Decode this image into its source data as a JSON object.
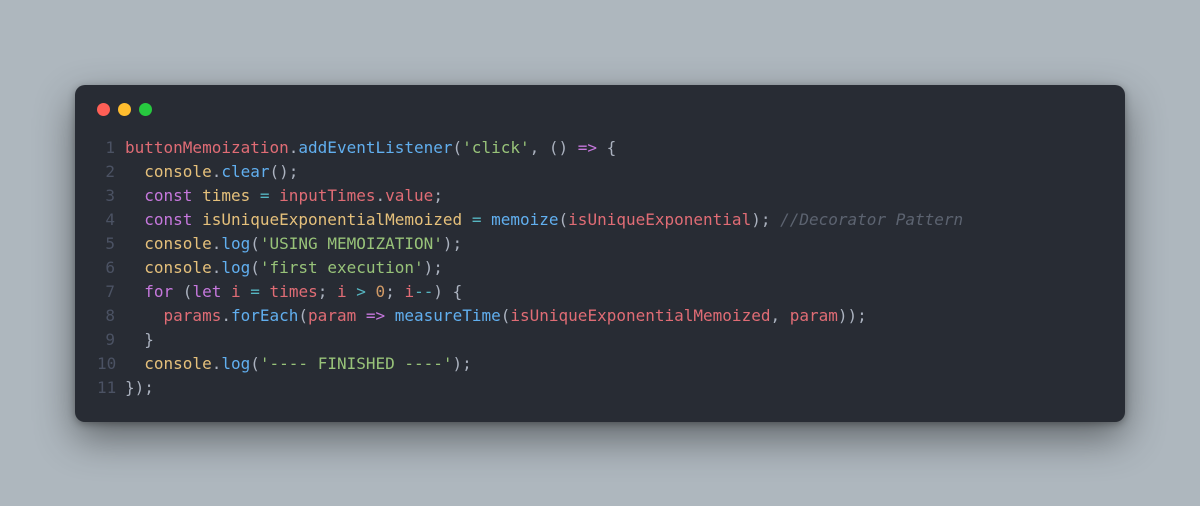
{
  "colors": {
    "bg_page": "#aeb7be",
    "bg_editor": "#282c34",
    "dot_red": "#ff5f56",
    "dot_yellow": "#ffbd2e",
    "dot_green": "#27c93f",
    "gutter": "#4b5263",
    "default": "#abb2bf",
    "method": "#61afef",
    "keyword": "#c678dd",
    "ident": "#e06c75",
    "number": "#d19a66",
    "string": "#98c379",
    "operator": "#56b6c2",
    "property": "#e5c07b",
    "comment": "#5c6370"
  },
  "chart_data": {
    "type": "table",
    "title": "Code snippet (JavaScript)",
    "lines": [
      "buttonMemoization.addEventListener('click', () => {",
      "  console.clear();",
      "  const times = inputTimes.value;",
      "  const isUniqueExponentialMemoized = memoize(isUniqueExponential); //Decorator Pattern",
      "  console.log('USING MEMOIZATION');",
      "  console.log('first execution');",
      "  for (let i = times; i > 0; i--) {",
      "    params.forEach(param => measureTime(isUniqueExponentialMemoized, param));",
      "  }",
      "  console.log('---- FINISHED ----');",
      "});"
    ]
  },
  "code": [
    {
      "n": "1",
      "t": [
        {
          "c": "tok-red",
          "s": "buttonMemoization"
        },
        {
          "c": "tok-default",
          "s": "."
        },
        {
          "c": "tok-method",
          "s": "addEventListener"
        },
        {
          "c": "tok-default",
          "s": "("
        },
        {
          "c": "tok-green",
          "s": "'click'"
        },
        {
          "c": "tok-default",
          "s": ", () "
        },
        {
          "c": "tok-purple",
          "s": "=>"
        },
        {
          "c": "tok-default",
          "s": " {"
        }
      ]
    },
    {
      "n": "2",
      "t": [
        {
          "c": "tok-default",
          "s": "  "
        },
        {
          "c": "tok-yellow",
          "s": "console"
        },
        {
          "c": "tok-default",
          "s": "."
        },
        {
          "c": "tok-method",
          "s": "clear"
        },
        {
          "c": "tok-default",
          "s": "();"
        }
      ]
    },
    {
      "n": "3",
      "t": [
        {
          "c": "tok-default",
          "s": "  "
        },
        {
          "c": "tok-purple",
          "s": "const"
        },
        {
          "c": "tok-default",
          "s": " "
        },
        {
          "c": "tok-yellow",
          "s": "times"
        },
        {
          "c": "tok-default",
          "s": " "
        },
        {
          "c": "tok-cyan",
          "s": "="
        },
        {
          "c": "tok-default",
          "s": " "
        },
        {
          "c": "tok-red",
          "s": "inputTimes"
        },
        {
          "c": "tok-default",
          "s": "."
        },
        {
          "c": "tok-red",
          "s": "value"
        },
        {
          "c": "tok-default",
          "s": ";"
        }
      ]
    },
    {
      "n": "4",
      "t": [
        {
          "c": "tok-default",
          "s": "  "
        },
        {
          "c": "tok-purple",
          "s": "const"
        },
        {
          "c": "tok-default",
          "s": " "
        },
        {
          "c": "tok-yellow",
          "s": "isUniqueExponentialMemoized"
        },
        {
          "c": "tok-default",
          "s": " "
        },
        {
          "c": "tok-cyan",
          "s": "="
        },
        {
          "c": "tok-default",
          "s": " "
        },
        {
          "c": "tok-method",
          "s": "memoize"
        },
        {
          "c": "tok-default",
          "s": "("
        },
        {
          "c": "tok-red",
          "s": "isUniqueExponential"
        },
        {
          "c": "tok-default",
          "s": "); "
        },
        {
          "c": "tok-comment",
          "s": "//Decorator Pattern"
        }
      ]
    },
    {
      "n": "5",
      "t": [
        {
          "c": "tok-default",
          "s": "  "
        },
        {
          "c": "tok-yellow",
          "s": "console"
        },
        {
          "c": "tok-default",
          "s": "."
        },
        {
          "c": "tok-method",
          "s": "log"
        },
        {
          "c": "tok-default",
          "s": "("
        },
        {
          "c": "tok-green",
          "s": "'USING MEMOIZATION'"
        },
        {
          "c": "tok-default",
          "s": ");"
        }
      ]
    },
    {
      "n": "6",
      "t": [
        {
          "c": "tok-default",
          "s": "  "
        },
        {
          "c": "tok-yellow",
          "s": "console"
        },
        {
          "c": "tok-default",
          "s": "."
        },
        {
          "c": "tok-method",
          "s": "log"
        },
        {
          "c": "tok-default",
          "s": "("
        },
        {
          "c": "tok-green",
          "s": "'first execution'"
        },
        {
          "c": "tok-default",
          "s": ");"
        }
      ]
    },
    {
      "n": "7",
      "t": [
        {
          "c": "tok-default",
          "s": "  "
        },
        {
          "c": "tok-purple",
          "s": "for"
        },
        {
          "c": "tok-default",
          "s": " ("
        },
        {
          "c": "tok-purple",
          "s": "let"
        },
        {
          "c": "tok-default",
          "s": " "
        },
        {
          "c": "tok-red",
          "s": "i"
        },
        {
          "c": "tok-default",
          "s": " "
        },
        {
          "c": "tok-cyan",
          "s": "="
        },
        {
          "c": "tok-default",
          "s": " "
        },
        {
          "c": "tok-red",
          "s": "times"
        },
        {
          "c": "tok-default",
          "s": "; "
        },
        {
          "c": "tok-red",
          "s": "i"
        },
        {
          "c": "tok-default",
          "s": " "
        },
        {
          "c": "tok-cyan",
          "s": ">"
        },
        {
          "c": "tok-default",
          "s": " "
        },
        {
          "c": "tok-orange",
          "s": "0"
        },
        {
          "c": "tok-default",
          "s": "; "
        },
        {
          "c": "tok-red",
          "s": "i"
        },
        {
          "c": "tok-cyan",
          "s": "--"
        },
        {
          "c": "tok-default",
          "s": ") {"
        }
      ]
    },
    {
      "n": "8",
      "t": [
        {
          "c": "tok-default",
          "s": "    "
        },
        {
          "c": "tok-red",
          "s": "params"
        },
        {
          "c": "tok-default",
          "s": "."
        },
        {
          "c": "tok-method",
          "s": "forEach"
        },
        {
          "c": "tok-default",
          "s": "("
        },
        {
          "c": "tok-red",
          "s": "param"
        },
        {
          "c": "tok-default",
          "s": " "
        },
        {
          "c": "tok-purple",
          "s": "=>"
        },
        {
          "c": "tok-default",
          "s": " "
        },
        {
          "c": "tok-method",
          "s": "measureTime"
        },
        {
          "c": "tok-default",
          "s": "("
        },
        {
          "c": "tok-red",
          "s": "isUniqueExponentialMemoized"
        },
        {
          "c": "tok-default",
          "s": ", "
        },
        {
          "c": "tok-red",
          "s": "param"
        },
        {
          "c": "tok-default",
          "s": "));"
        }
      ]
    },
    {
      "n": "9",
      "t": [
        {
          "c": "tok-default",
          "s": "  }"
        }
      ]
    },
    {
      "n": "10",
      "t": [
        {
          "c": "tok-default",
          "s": "  "
        },
        {
          "c": "tok-yellow",
          "s": "console"
        },
        {
          "c": "tok-default",
          "s": "."
        },
        {
          "c": "tok-method",
          "s": "log"
        },
        {
          "c": "tok-default",
          "s": "("
        },
        {
          "c": "tok-green",
          "s": "'---- FINISHED ----'"
        },
        {
          "c": "tok-default",
          "s": ");"
        }
      ]
    },
    {
      "n": "11",
      "t": [
        {
          "c": "tok-default",
          "s": "});"
        }
      ]
    }
  ]
}
